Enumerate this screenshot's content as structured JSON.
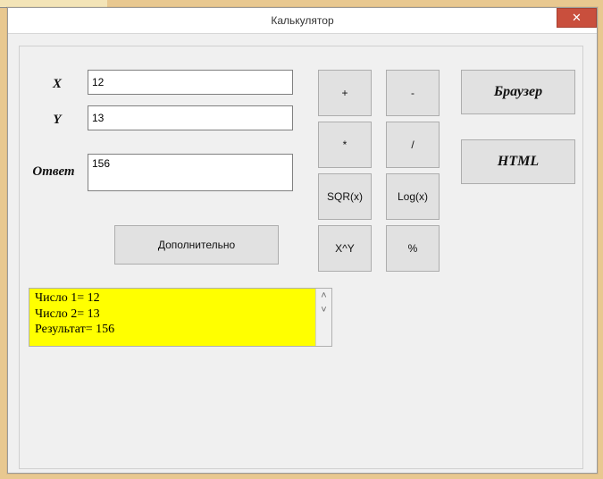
{
  "window": {
    "title": "Калькулятор",
    "close_glyph": "✕"
  },
  "labels": {
    "x": "X",
    "y": "Y",
    "answer": "Ответ"
  },
  "inputs": {
    "x": "12",
    "y": "13",
    "answer": "156"
  },
  "ops": {
    "plus": "+",
    "minus": "-",
    "mul": "*",
    "div": "/",
    "sqr": "SQR(x)",
    "log": "Log(x)",
    "pow": "X^Y",
    "mod": "%"
  },
  "buttons": {
    "extra": "Дополнительно",
    "browser": "Браузер",
    "html": "HTML"
  },
  "log": "Число 1= 12\nЧисло 2= 13\nРезультат= 156",
  "scroll": {
    "up": "˄",
    "down": "˅"
  },
  "colors": {
    "log_bg": "#ffff00",
    "close_bg": "#c94f3d"
  }
}
